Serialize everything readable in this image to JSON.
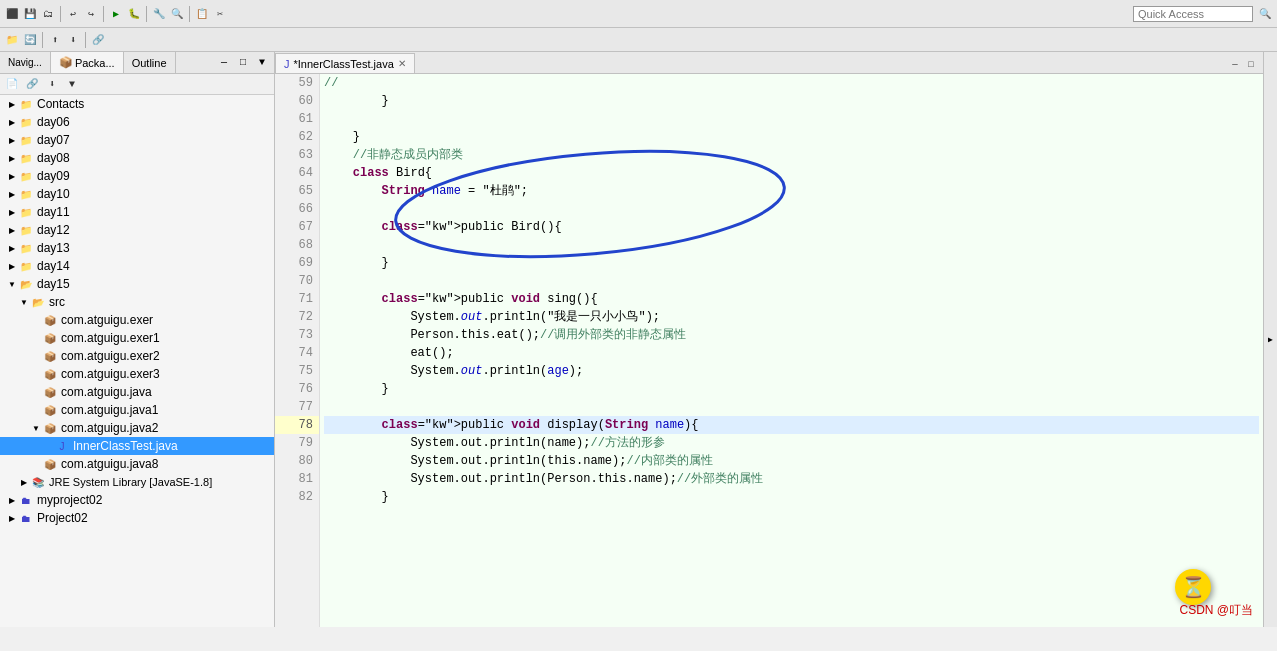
{
  "toolbar": {
    "quickAccess": "Quick Access"
  },
  "leftPanel": {
    "tabs": [
      {
        "label": "Navig...",
        "active": false
      },
      {
        "label": "Packa...",
        "active": true
      },
      {
        "label": "Outline",
        "active": false
      }
    ]
  },
  "treeItems": [
    {
      "id": "contacts",
      "label": "Contacts",
      "indent": 0,
      "hasArrow": true,
      "expanded": false,
      "icon": "folder"
    },
    {
      "id": "day06",
      "label": "day06",
      "indent": 0,
      "hasArrow": true,
      "expanded": false,
      "icon": "folder"
    },
    {
      "id": "day07",
      "label": "day07",
      "indent": 0,
      "hasArrow": true,
      "expanded": false,
      "icon": "folder"
    },
    {
      "id": "day08",
      "label": "day08",
      "indent": 0,
      "hasArrow": true,
      "expanded": false,
      "icon": "folder"
    },
    {
      "id": "day09",
      "label": "day09",
      "indent": 0,
      "hasArrow": true,
      "expanded": false,
      "icon": "folder"
    },
    {
      "id": "day10",
      "label": "day10",
      "indent": 0,
      "hasArrow": true,
      "expanded": false,
      "icon": "folder"
    },
    {
      "id": "day11",
      "label": "day11",
      "indent": 0,
      "hasArrow": true,
      "expanded": false,
      "icon": "folder"
    },
    {
      "id": "day12",
      "label": "day12",
      "indent": 0,
      "hasArrow": true,
      "expanded": false,
      "icon": "folder"
    },
    {
      "id": "day13",
      "label": "day13",
      "indent": 0,
      "hasArrow": true,
      "expanded": false,
      "icon": "folder"
    },
    {
      "id": "day14",
      "label": "day14",
      "indent": 0,
      "hasArrow": true,
      "expanded": false,
      "icon": "folder"
    },
    {
      "id": "day15",
      "label": "day15",
      "indent": 0,
      "hasArrow": true,
      "expanded": true,
      "icon": "folder"
    },
    {
      "id": "src",
      "label": "src",
      "indent": 1,
      "hasArrow": true,
      "expanded": true,
      "icon": "src"
    },
    {
      "id": "pkg1",
      "label": "com.atguigu.exer",
      "indent": 2,
      "hasArrow": false,
      "expanded": false,
      "icon": "pkg"
    },
    {
      "id": "pkg2",
      "label": "com.atguigu.exer1",
      "indent": 2,
      "hasArrow": false,
      "expanded": false,
      "icon": "pkg"
    },
    {
      "id": "pkg3",
      "label": "com.atguigu.exer2",
      "indent": 2,
      "hasArrow": false,
      "expanded": false,
      "icon": "pkg"
    },
    {
      "id": "pkg4",
      "label": "com.atguigu.exer3",
      "indent": 2,
      "hasArrow": false,
      "expanded": false,
      "icon": "pkg"
    },
    {
      "id": "pkg5",
      "label": "com.atguigu.java",
      "indent": 2,
      "hasArrow": false,
      "expanded": false,
      "icon": "pkg"
    },
    {
      "id": "pkg6",
      "label": "com.atguigu.java1",
      "indent": 2,
      "hasArrow": false,
      "expanded": false,
      "icon": "pkg"
    },
    {
      "id": "pkg7",
      "label": "com.atguigu.java2",
      "indent": 2,
      "hasArrow": true,
      "expanded": true,
      "icon": "pkg"
    },
    {
      "id": "file1",
      "label": "InnerClassTest.java",
      "indent": 3,
      "hasArrow": false,
      "expanded": false,
      "icon": "java",
      "selected": true
    },
    {
      "id": "pkg8",
      "label": "com.atguigu.java8",
      "indent": 2,
      "hasArrow": false,
      "expanded": false,
      "icon": "pkg"
    },
    {
      "id": "jre",
      "label": "JRE System Library [JavaSE-1.8]",
      "indent": 1,
      "hasArrow": false,
      "expanded": false,
      "icon": "lib"
    },
    {
      "id": "myproject02",
      "label": "myproject02",
      "indent": 0,
      "hasArrow": true,
      "expanded": false,
      "icon": "project"
    },
    {
      "id": "project02",
      "label": "Project02",
      "indent": 0,
      "hasArrow": true,
      "expanded": false,
      "icon": "project"
    }
  ],
  "editorTab": {
    "filename": "*InnerClassTest.java",
    "icon": "java-file"
  },
  "lines": [
    {
      "num": 59,
      "content": "//",
      "highlighted": false
    },
    {
      "num": 60,
      "content": "        }",
      "highlighted": false
    },
    {
      "num": 61,
      "content": "",
      "highlighted": false
    },
    {
      "num": 62,
      "content": "    }",
      "highlighted": false
    },
    {
      "num": 63,
      "content": "    //非静态成员内部类",
      "highlighted": false
    },
    {
      "num": 64,
      "content": "    class Bird{",
      "highlighted": false
    },
    {
      "num": 65,
      "content": "        String name = \"杜鹃\";",
      "highlighted": false
    },
    {
      "num": 66,
      "content": "",
      "highlighted": false
    },
    {
      "num": 67,
      "content": "        public Bird(){",
      "highlighted": false
    },
    {
      "num": 68,
      "content": "",
      "highlighted": false
    },
    {
      "num": 69,
      "content": "        }",
      "highlighted": false
    },
    {
      "num": 70,
      "content": "",
      "highlighted": false
    },
    {
      "num": 71,
      "content": "        public void sing(){",
      "highlighted": false
    },
    {
      "num": 72,
      "content": "            System.out.println(\"我是一只小小鸟\");",
      "highlighted": false
    },
    {
      "num": 73,
      "content": "            Person.this.eat();//调用外部类的非静态属性",
      "highlighted": false
    },
    {
      "num": 74,
      "content": "            eat();",
      "highlighted": false
    },
    {
      "num": 75,
      "content": "            System.out.println(age);",
      "highlighted": false
    },
    {
      "num": 76,
      "content": "        }",
      "highlighted": false
    },
    {
      "num": 77,
      "content": "",
      "highlighted": false
    },
    {
      "num": 78,
      "content": "        public void display(String name){",
      "highlighted": true
    },
    {
      "num": 79,
      "content": "            System.out.println(name);//方法的形参",
      "highlighted": false
    },
    {
      "num": 80,
      "content": "            System.out.println(this.name);//内部类的属性",
      "highlighted": false
    },
    {
      "num": 81,
      "content": "            System.out.println(Person.this.name);//外部类的属性",
      "highlighted": false
    },
    {
      "num": 82,
      "content": "        }",
      "highlighted": false
    }
  ],
  "watermark": "CSDN @叮当"
}
